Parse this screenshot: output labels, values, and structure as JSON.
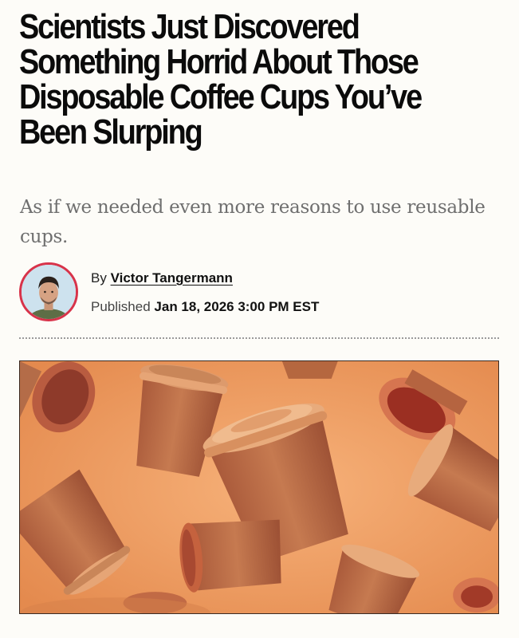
{
  "article": {
    "headline_lines": [
      "Scientists Just Discovered",
      "Something Horrid About Those",
      "Disposable Coffee Cups You’ve",
      "Been Slurping"
    ],
    "dek": "As if we needed even more reasons to use reusable cups.",
    "byline": {
      "prefix": "By",
      "author": "Victor Tangermann"
    },
    "published": {
      "prefix": "Published",
      "date": "Jan 18, 2026 3:00 PM EST"
    }
  },
  "colors": {
    "avatar_ring": "#d8334a",
    "hero_bg": "#f2a56a",
    "cup_body": "#c4764b",
    "cup_lid": "#e0996a"
  },
  "hero_image": {
    "subject": "disposable-coffee-cups-illustration"
  }
}
